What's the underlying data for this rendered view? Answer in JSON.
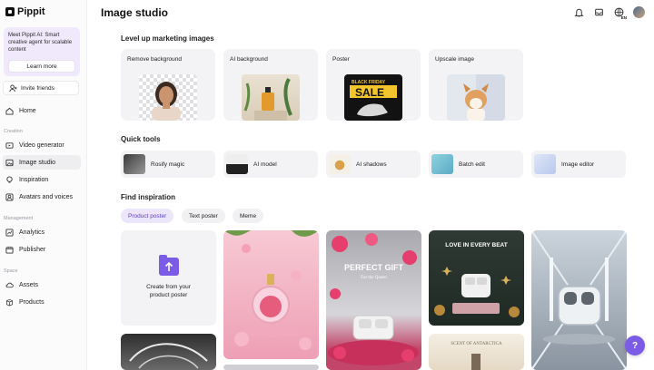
{
  "app": {
    "name": "Pippit"
  },
  "sidebar": {
    "promo_text": "Meet Pippit AI: Smart creative agent for scalable content",
    "promo_button": "Learn more",
    "invite_label": "Invite friends",
    "home_label": "Home",
    "sections": {
      "creation": "Creation",
      "management": "Management",
      "space": "Space"
    },
    "creation_items": [
      {
        "label": "Video generator",
        "icon": "video-icon"
      },
      {
        "label": "Image studio",
        "icon": "image-icon",
        "active": true
      },
      {
        "label": "Inspiration",
        "icon": "bulb-icon"
      },
      {
        "label": "Avatars and voices",
        "icon": "avatar-icon"
      }
    ],
    "management_items": [
      {
        "label": "Analytics",
        "icon": "analytics-icon"
      },
      {
        "label": "Publisher",
        "icon": "calendar-icon"
      }
    ],
    "space_items": [
      {
        "label": "Assets",
        "icon": "cloud-icon"
      },
      {
        "label": "Products",
        "icon": "box-icon"
      }
    ]
  },
  "header": {
    "title": "Image studio",
    "lang_code": "EN"
  },
  "level_up": {
    "title": "Level up marketing images",
    "cards": [
      "Remove background",
      "AI background",
      "Poster",
      "Upscale image"
    ]
  },
  "poster_thumb": {
    "line1": "BLACK FRIDAY",
    "line2": "SALE"
  },
  "quick_tools": {
    "title": "Quick tools",
    "items": [
      "Rosify magic",
      "AI model",
      "AI shadows",
      "Batch edit",
      "Image editor"
    ]
  },
  "inspiration": {
    "title": "Find inspiration",
    "tabs": [
      "Product poster",
      "Text poster",
      "Meme"
    ],
    "create_text": "Create from your product poster",
    "tile_texts": {
      "perfect_gift": "PERFECT GIFT",
      "for_queen": "For the Queen",
      "love_beat": "LOVE IN EVERY BEAT",
      "scent": "SCENT OF ANTARCTICA"
    }
  },
  "help_icon": "?",
  "colors": {
    "accent": "#7b5ce6",
    "promo_bg": "#efe9fb",
    "card_bg": "#f3f3f5"
  }
}
